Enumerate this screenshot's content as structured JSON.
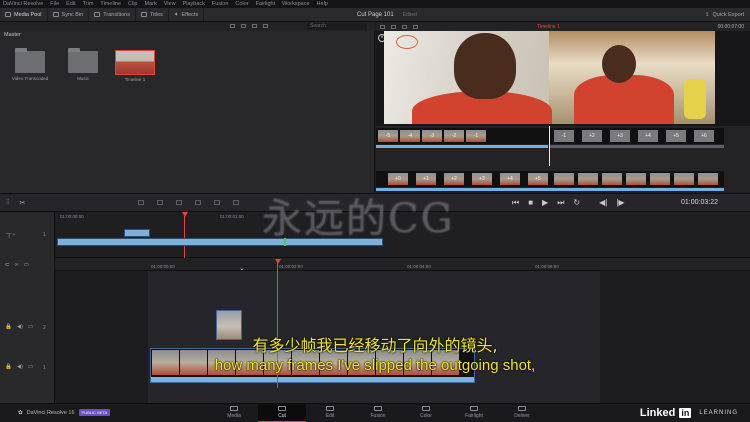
{
  "menu": [
    "DaVinci Resolve",
    "File",
    "Edit",
    "Trim",
    "Timeline",
    "Clip",
    "Mark",
    "View",
    "Playback",
    "Fusion",
    "Color",
    "Fairlight",
    "Workspace",
    "Help"
  ],
  "toolbar": {
    "media_pool": "Media Pool",
    "sync_bin": "Sync Bin",
    "transitions": "Transitions",
    "titles": "Titles",
    "effects": "Effects",
    "page_title": "Cut Page 101",
    "page_status": "Edited",
    "quick_export": "Quick Export"
  },
  "media_pool": {
    "search_placeholder": "Search",
    "bin_name": "Master",
    "items": [
      "Video Transcoded",
      "Music",
      "Timeline 1"
    ]
  },
  "viewer": {
    "timeline_name": "Timeline 1",
    "timecode": "00:00:07:00"
  },
  "trim_strip": {
    "upper_frames": [
      "-5",
      "-4",
      "-3",
      "-2",
      "-1",
      "-1",
      "+2",
      "+3",
      "+4",
      "+5",
      "+6"
    ],
    "lower_frames": [
      "+0",
      "+1",
      "+2",
      "+3",
      "+4",
      "+5"
    ]
  },
  "transport": {
    "timecode": "01:00:03:22"
  },
  "upper_timeline": {
    "ruler": [
      "01:00:00:00",
      "01:00:01:00"
    ],
    "track_number": "1"
  },
  "lower_timeline": {
    "ruler": [
      "01:00:00:00",
      "01:00:02:00",
      "01:00:04:00",
      "01:00:06:00"
    ],
    "tracks": [
      "2",
      "1"
    ]
  },
  "subtitle": {
    "zh": "有多少帧我已经移动了向外的镜头,",
    "en": "how many frames I've slipped the outgoing shot,"
  },
  "watermark": "永远的CG",
  "bottombar": {
    "product": "DaVinci Resolve 16",
    "badge": "PUBLIC BETA",
    "pages": [
      "Media",
      "Cut",
      "Edit",
      "Fusion",
      "Color",
      "Fairlight",
      "Deliver"
    ],
    "active_page": "Cut",
    "linkedin_1": "Linked",
    "linkedin_2": "in",
    "learning": "LEARNING"
  },
  "colors": {
    "accent": "#e0453a",
    "clip_blue": "#7fb0dc",
    "subtitle": "#f0e81c"
  }
}
